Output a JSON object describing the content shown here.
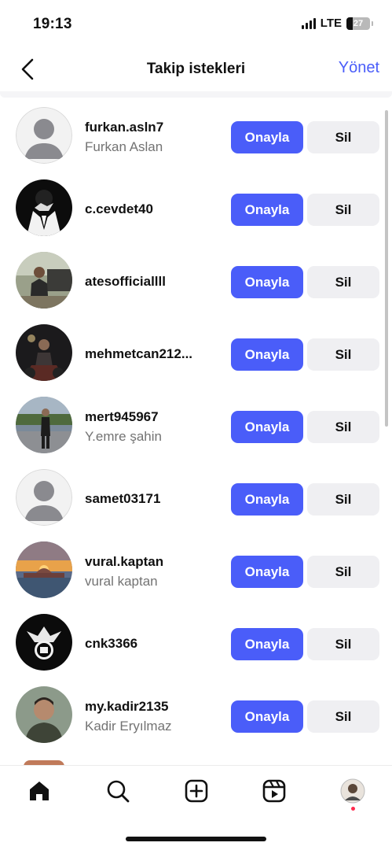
{
  "status_bar": {
    "time": "19:13",
    "network": "LTE",
    "battery": "27",
    "battery_level": 0.27
  },
  "header": {
    "title": "Takip istekleri",
    "manage": "Yönet"
  },
  "requests": [
    {
      "username": "furkan.asln7",
      "full_name": "Furkan Aslan",
      "approve": "Onayla",
      "delete": "Sil",
      "avatar": "default-avatar"
    },
    {
      "username": "c.cevdet40",
      "full_name": "",
      "approve": "Onayla",
      "delete": "Sil",
      "avatar": "suit-photo"
    },
    {
      "username": "atesofficiallll",
      "full_name": "",
      "approve": "Onayla",
      "delete": "Sil",
      "avatar": "photo"
    },
    {
      "username": "mehmetcan212...",
      "full_name": "",
      "approve": "Onayla",
      "delete": "Sil",
      "avatar": "night-photo"
    },
    {
      "username": "mert945967",
      "full_name": "Y.emre şahin",
      "approve": "Onayla",
      "delete": "Sil",
      "avatar": "street-photo"
    },
    {
      "username": "samet03171",
      "full_name": "",
      "approve": "Onayla",
      "delete": "Sil",
      "avatar": "default-avatar"
    },
    {
      "username": "vural.kaptan",
      "full_name": "vural kaptan",
      "approve": "Onayla",
      "delete": "Sil",
      "avatar": "sunset-photo"
    },
    {
      "username": "cnk3366",
      "full_name": "",
      "approve": "Onayla",
      "delete": "Sil",
      "avatar": "eagle-logo"
    },
    {
      "username": "my.kadir2135",
      "full_name": "Kadir Eryılmaz",
      "approve": "Onayla",
      "delete": "Sil",
      "avatar": "portrait-photo"
    }
  ],
  "tab_bar": {
    "items": [
      "home-icon",
      "search-icon",
      "create-icon",
      "reels-icon",
      "profile-avatar"
    ]
  },
  "colors": {
    "accent": "#4a5df9",
    "secondary_button": "#efeff2",
    "muted_text": "#737373",
    "notification_dot": "#ff2a4d"
  }
}
